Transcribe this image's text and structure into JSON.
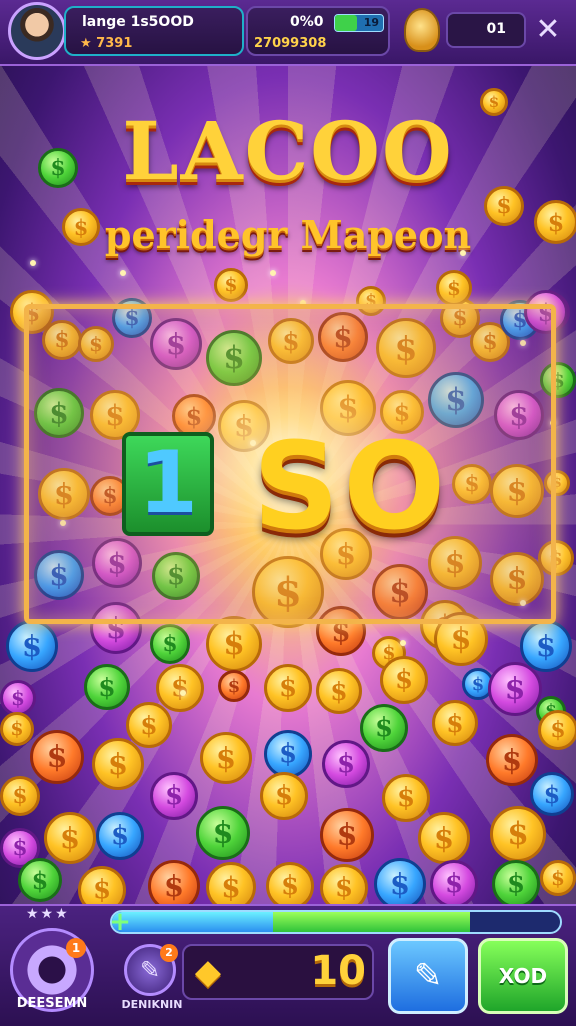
{
  "header": {
    "player_name": "lange 1s5OOD",
    "player_stars": "★ 7391",
    "coin_percent": "0%0",
    "energy_value": "19",
    "energy_fill": 0.45,
    "coin_total": "27099308",
    "gems_value": "01",
    "close_label": "✕"
  },
  "title": {
    "main": "LACOO",
    "subtitle": "peridegr Mapeon"
  },
  "frame": {
    "one_label": "1",
    "value": "SO"
  },
  "icons": {
    "avatar": "avatar-icon",
    "trophy": "trophy-icon",
    "gear": "gear-icon",
    "boost": "pencil-icon",
    "diamond": "diamond-icon",
    "eraser": "eraser-icon"
  },
  "bottom": {
    "stars_label": "★★★",
    "gear_label": "DEESEMN",
    "gear_badge": "1",
    "boost_label": "DENIKNIN",
    "boost_badge": "2",
    "plus_label": "+",
    "progress_blue": 0.36,
    "progress_green": 0.44,
    "score_value": "10",
    "diamond_glyph": "◆",
    "eraser_glyph": "✎",
    "green_button_label": "XOD"
  }
}
